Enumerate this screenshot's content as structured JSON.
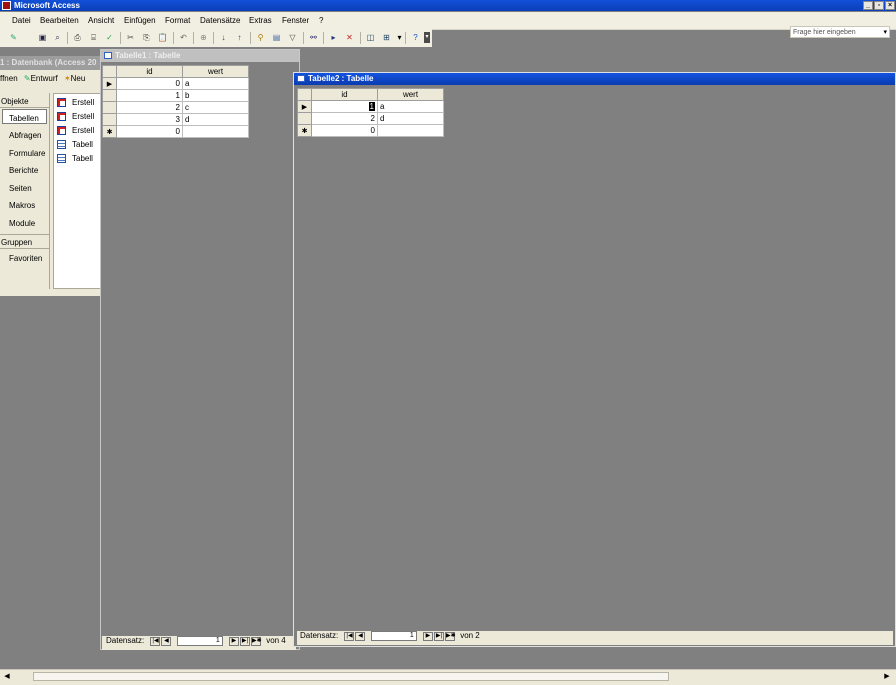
{
  "app": {
    "title": "Microsoft Access"
  },
  "window_controls": {
    "minimize": "_",
    "restore": "▫",
    "close": "×"
  },
  "menu": {
    "items": [
      "Datei",
      "Bearbeiten",
      "Ansicht",
      "Einfügen",
      "Format",
      "Datensätze",
      "Extras",
      "Fenster",
      "?"
    ],
    "help_placeholder": "Frage hier eingeben"
  },
  "database_window": {
    "title": "1 : Datenbank (Access 20",
    "toolbar": {
      "open": "ffnen",
      "design": "Entwurf",
      "new": "Neu"
    },
    "objects_header": "Objekte",
    "objects": [
      "Tabellen",
      "Abfragen",
      "Formulare",
      "Berichte",
      "Seiten",
      "Makros",
      "Module"
    ],
    "groups_header": "Gruppen",
    "groups": [
      "Favoriten"
    ],
    "list": [
      "Erstell",
      "Erstell",
      "Erstell",
      "Tabell",
      "Tabell"
    ]
  },
  "tabelle1": {
    "title": "Tabelle1 : Tabelle",
    "columns": [
      "id",
      "wert"
    ],
    "rows": [
      {
        "marker": "▶",
        "id": "0",
        "wert": "a"
      },
      {
        "marker": "",
        "id": "1",
        "wert": "b"
      },
      {
        "marker": "",
        "id": "2",
        "wert": "c"
      },
      {
        "marker": "",
        "id": "3",
        "wert": "d"
      },
      {
        "marker": "✱",
        "id": "0",
        "wert": ""
      }
    ],
    "nav": {
      "label": "Datensatz:",
      "current": "1",
      "of_text": "von 4"
    }
  },
  "tabelle2": {
    "title": "Tabelle2 : Tabelle",
    "columns": [
      "id",
      "wert"
    ],
    "rows": [
      {
        "marker": "▶",
        "id": "1",
        "wert": "a"
      },
      {
        "marker": "",
        "id": "2",
        "wert": "d"
      },
      {
        "marker": "✱",
        "id": "0",
        "wert": ""
      }
    ],
    "nav": {
      "label": "Datensatz:",
      "current": "1",
      "of_text": "von 2"
    }
  }
}
